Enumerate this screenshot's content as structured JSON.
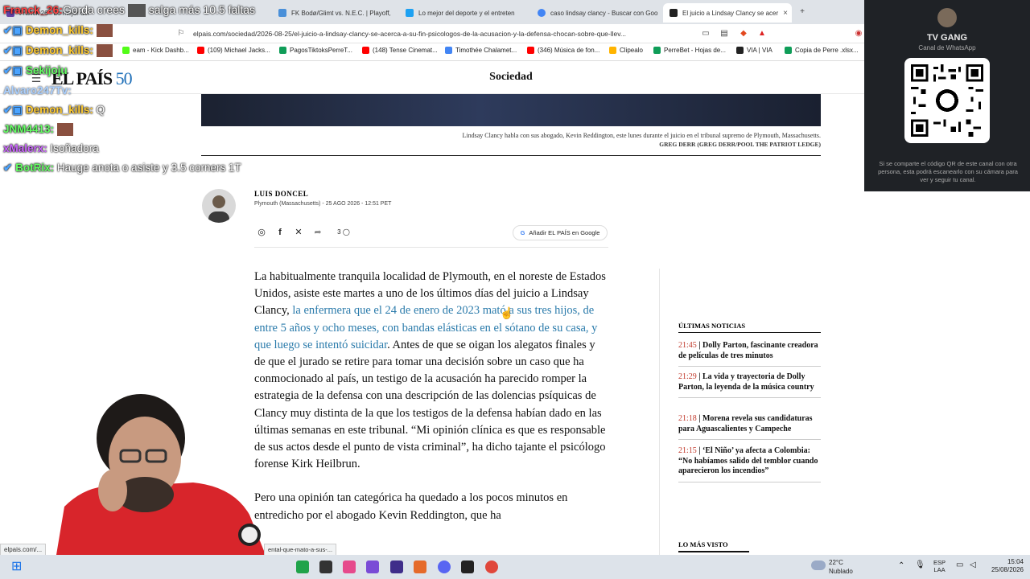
{
  "browser": {
    "tabs": [
      {
        "label": "Franck 26 · Lo mejor del",
        "color": "#6441a5"
      },
      {
        "label": "FK Bodø/Glimt vs. N.E.C. | Playoff, vue",
        "color": "#4a90d9"
      },
      {
        "label": "Lo mejor del deporte y el entreten",
        "color": "#1da1f2"
      },
      {
        "label": "caso lindsay clancy - Buscar con Goo",
        "color": "#4285f4"
      },
      {
        "label": "El juicio a Lindsay Clancy se acer",
        "color": "#222222"
      }
    ],
    "new_tab": "+",
    "close_tab": "×",
    "url": "elpais.com/sociedad/2026-08-25/el-juicio-a-lindsay-clancy-se-acerca-a-su-fin-psicologos-de-la-acusacion-y-la-defensa-chocan-sobre-que-llev...",
    "bookmarks": [
      {
        "label": "eam - Kick Dashb...",
        "color": "#53fc18"
      },
      {
        "label": "(109) Michael Jacks...",
        "color": "#ff0000"
      },
      {
        "label": "PagosTiktoksPerreT...",
        "color": "#0f9d58"
      },
      {
        "label": "(148) Tense Cinemat...",
        "color": "#ff0000"
      },
      {
        "label": "Timothée Chalamet...",
        "color": "#4285f4"
      },
      {
        "label": "(346) Música de fon...",
        "color": "#ff0000"
      },
      {
        "label": "Clipealo",
        "color": "#ffb400"
      },
      {
        "label": "PerreBet - Hojas de...",
        "color": "#0f9d58"
      },
      {
        "label": "VIA | VIA",
        "color": "#222222"
      },
      {
        "label": "Copia de Perre .xlsx...",
        "color": "#0f9d58"
      }
    ]
  },
  "whatsapp": {
    "name": "TV GANG",
    "subtitle": "Canal de WhatsApp",
    "note": "Si se comparte el código QR de este canal con otra persona, esta podrá escanearlo con su cámara para ver y seguir tu canal."
  },
  "site": {
    "logo": "EL PAÍS",
    "logo_badge": "50",
    "section": "Sociedad"
  },
  "photo": {
    "caption": "Lindsay Clancy habla con sus abogado, Kevin Reddington, este lunes durante el juicio en el tribunal supremo de Plymouth, Massachusetts.",
    "credit": "GREG DERR (GREG DERR/POOL THE PATRIOT LEDGE)"
  },
  "byline": {
    "author": "LUIS DONCEL",
    "dateline": "Plymouth (Massachusetts) - 25 AGO 2026 - 12:51 PET",
    "comments": "3",
    "google_button": "Añadir EL PAÍS en Google"
  },
  "article": {
    "p1_a": "La habitualmente tranquila localidad de Plymouth, en el noreste de Estados Unidos, asiste este martes a uno de los últimos días del juicio a Lindsay Clancy, ",
    "p1_link": "la enfermera que el 24 de enero de 2023 mató a sus tres hijos, de entre 5 años y ocho meses, con bandas elásticas en el sótano de su casa, y que luego se intentó suicidar",
    "p1_b": ". Antes de que se oigan los alegatos finales y de que el jurado se retire para tomar una decisión sobre un caso que ha conmocionado al país, un testigo de la acusación ha parecido romper la estrategia de la defensa con una descripción de las dolencias psíquicas de Clancy muy distinta de la que los testigos de la defensa habían dado en las últimas semanas en este tribunal. “Mi opinión clínica es que es responsable de sus actos desde el punto de vista criminal”, ha dicho tajante el psicólogo forense Kirk Heilbrun.",
    "p2": "Pero una opinión tan categórica ha quedado a los pocos minutos en entredicho por el abogado Kevin Reddington, que ha"
  },
  "sidebar": {
    "latest_title": "ÚLTIMAS NOTICIAS",
    "latest": [
      {
        "time": "21:45",
        "title": "Dolly Parton, fascinante creadora de películas de tres minutos"
      },
      {
        "time": "21:29",
        "title": "La vida y trayectoria de Dolly Parton, la leyenda de la música country"
      },
      {
        "time": "21:18",
        "title": "Morena revela sus candidaturas para Aguascalientes y Campeche"
      },
      {
        "time": "21:15",
        "title": "‘El Niño’ ya afecta a Colombia: “No habíamos salido del temblor cuando aparecieron los incendios”"
      }
    ],
    "most_read_title": "LO MÁS VISTO"
  },
  "chat": [
    {
      "user": "Franck_26:",
      "msg": "Gorda crees",
      "msg2": "salga más 10.5 faltas",
      "color": "#ff4444"
    },
    {
      "user": "Demon_kills:",
      "msg": "",
      "color": "#ffcc33"
    },
    {
      "user": "Demon_kills:",
      "msg": "",
      "color": "#ffcc33"
    },
    {
      "user": "Sekijoju",
      "msg": "",
      "color": "#66ff66"
    },
    {
      "user": "Alvaro247Tv:",
      "msg": "",
      "color": "#66aaff"
    },
    {
      "user": "Demon_kills:",
      "msg": "Q",
      "color": "#ffcc33"
    },
    {
      "user": "JNM4413:",
      "msg": "",
      "color": "#66ff66"
    },
    {
      "user": "xMalerx:",
      "msg": "Isoñadora",
      "color": "#cc66ff"
    },
    {
      "user": "BotRix:",
      "msg": "Hauge anota o asiste y 3.5 corners 1T",
      "color": "#66ff66"
    }
  ],
  "status_urls": [
    "elpais.com/...",
    "ental-que-mato-a-sus-..."
  ],
  "taskbar": {
    "weather_temp": "22°C",
    "weather_desc": "Nublado",
    "lang1": "ESP",
    "lang2": "LAA",
    "time": "15:04",
    "date": "25/08/2026"
  }
}
